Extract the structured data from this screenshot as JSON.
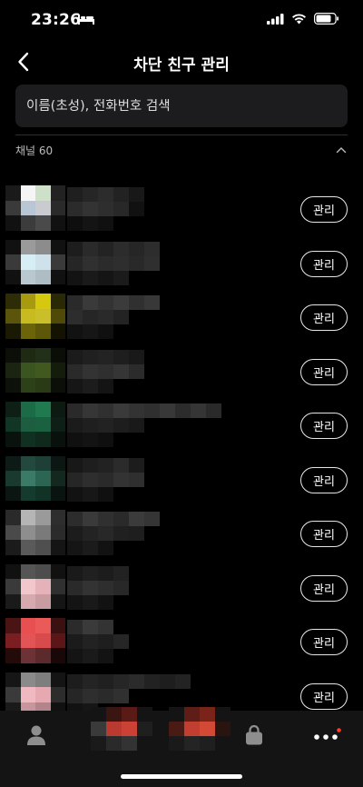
{
  "status_bar": {
    "time": "23:26",
    "icons": [
      "bed-icon",
      "cellular-signal-icon",
      "wifi-icon",
      "battery-icon"
    ]
  },
  "header": {
    "title": "차단 친구 관리",
    "back_icon": "chevron-left-icon"
  },
  "search": {
    "placeholder": "이름(초성), 전화번호 검색",
    "value": ""
  },
  "section": {
    "label": "채널 60",
    "expanded": true,
    "toggle_icon": "chevron-up-icon"
  },
  "friends": [
    {
      "manage_label": "관리"
    },
    {
      "manage_label": "관리"
    },
    {
      "manage_label": "관리"
    },
    {
      "manage_label": "관리"
    },
    {
      "manage_label": "관리"
    },
    {
      "manage_label": "관리"
    },
    {
      "manage_label": "관리"
    },
    {
      "manage_label": "관리"
    },
    {
      "manage_label": "관리"
    },
    {
      "manage_label": "관리"
    }
  ],
  "tab_bar": {
    "tabs": [
      "friends-tab",
      "chats-tab",
      "openchat-tab",
      "shopping-tab",
      "more-tab"
    ],
    "more_has_badge": true
  },
  "colors": {
    "background": "#000000",
    "search_bg": "#1c1c1e",
    "tab_bar_bg": "#141414",
    "badge": "#ff3b30"
  }
}
